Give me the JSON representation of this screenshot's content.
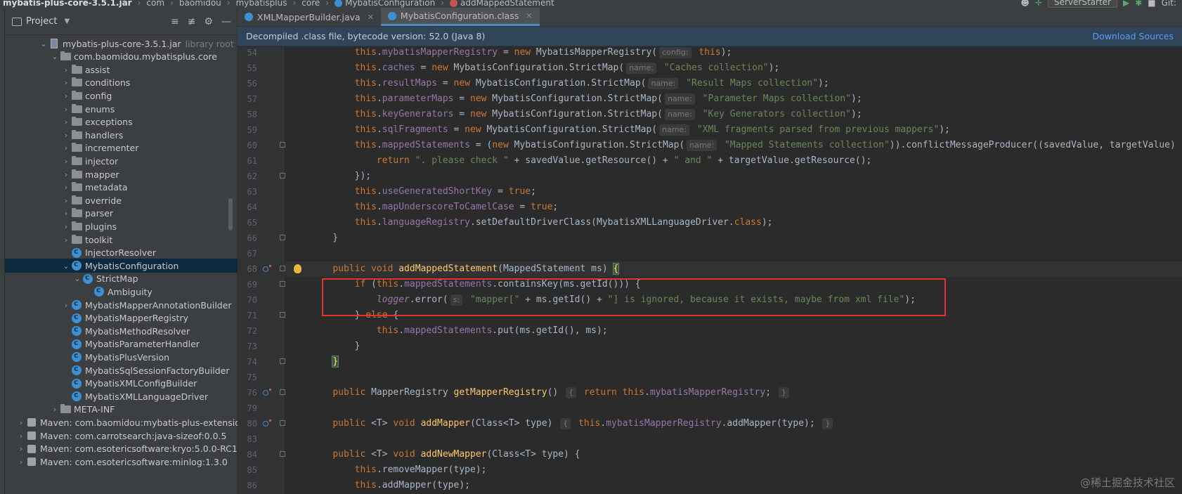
{
  "breadcrumb": {
    "items": [
      "mybatis-plus-core-3.5.1.jar",
      "com",
      "baomidou",
      "mybatisplus",
      "core",
      "MybatisConfiguration",
      "addMappedStatement"
    ]
  },
  "toolbar": {
    "run_config": "ServerStarter",
    "git_label": "Git:"
  },
  "project_panel": {
    "title": "Project",
    "tree": [
      {
        "label": "mybatis-plus-core-3.5.1.jar",
        "sub": "library root",
        "indent": 3,
        "arrow": "open",
        "icon": "jar"
      },
      {
        "label": "com.baomidou.mybatisplus.core",
        "indent": 4,
        "arrow": "open",
        "icon": "folder"
      },
      {
        "label": "assist",
        "indent": 5,
        "arrow": "closed",
        "icon": "folder"
      },
      {
        "label": "conditions",
        "indent": 5,
        "arrow": "closed",
        "icon": "folder"
      },
      {
        "label": "config",
        "indent": 5,
        "arrow": "closed",
        "icon": "folder"
      },
      {
        "label": "enums",
        "indent": 5,
        "arrow": "closed",
        "icon": "folder"
      },
      {
        "label": "exceptions",
        "indent": 5,
        "arrow": "closed",
        "icon": "folder"
      },
      {
        "label": "handlers",
        "indent": 5,
        "arrow": "closed",
        "icon": "folder"
      },
      {
        "label": "incrementer",
        "indent": 5,
        "arrow": "closed",
        "icon": "folder"
      },
      {
        "label": "injector",
        "indent": 5,
        "arrow": "closed",
        "icon": "folder"
      },
      {
        "label": "mapper",
        "indent": 5,
        "arrow": "closed",
        "icon": "folder"
      },
      {
        "label": "metadata",
        "indent": 5,
        "arrow": "closed",
        "icon": "folder"
      },
      {
        "label": "override",
        "indent": 5,
        "arrow": "closed",
        "icon": "folder"
      },
      {
        "label": "parser",
        "indent": 5,
        "arrow": "closed",
        "icon": "folder"
      },
      {
        "label": "plugins",
        "indent": 5,
        "arrow": "closed",
        "icon": "folder"
      },
      {
        "label": "toolkit",
        "indent": 5,
        "arrow": "closed",
        "icon": "folder"
      },
      {
        "label": "InjectorResolver",
        "indent": 5,
        "arrow": "none",
        "icon": "class"
      },
      {
        "label": "MybatisConfiguration",
        "indent": 5,
        "arrow": "open",
        "icon": "class",
        "selected": true
      },
      {
        "label": "StrictMap",
        "indent": 6,
        "arrow": "open",
        "icon": "class"
      },
      {
        "label": "Ambiguity",
        "indent": 7,
        "arrow": "none",
        "icon": "class"
      },
      {
        "label": "MybatisMapperAnnotationBuilder",
        "indent": 5,
        "arrow": "closed",
        "icon": "class"
      },
      {
        "label": "MybatisMapperRegistry",
        "indent": 5,
        "arrow": "none",
        "icon": "class"
      },
      {
        "label": "MybatisMethodResolver",
        "indent": 5,
        "arrow": "none",
        "icon": "class"
      },
      {
        "label": "MybatisParameterHandler",
        "indent": 5,
        "arrow": "none",
        "icon": "class"
      },
      {
        "label": "MybatisPlusVersion",
        "indent": 5,
        "arrow": "none",
        "icon": "class"
      },
      {
        "label": "MybatisSqlSessionFactoryBuilder",
        "indent": 5,
        "arrow": "none",
        "icon": "class"
      },
      {
        "label": "MybatisXMLConfigBuilder",
        "indent": 5,
        "arrow": "none",
        "icon": "class"
      },
      {
        "label": "MybatisXMLLanguageDriver",
        "indent": 5,
        "arrow": "none",
        "icon": "class"
      },
      {
        "label": "META-INF",
        "indent": 4,
        "arrow": "closed",
        "icon": "folder"
      },
      {
        "label": "Maven: com.baomidou:mybatis-plus-extension",
        "indent": 1,
        "arrow": "closed",
        "icon": "maven"
      },
      {
        "label": "Maven: com.carrotsearch:java-sizeof:0.0.5",
        "indent": 1,
        "arrow": "closed",
        "icon": "maven"
      },
      {
        "label": "Maven: com.esotericsoftware:kryo:5.0.0-RC1",
        "indent": 1,
        "arrow": "closed",
        "icon": "maven"
      },
      {
        "label": "Maven: com.esotericsoftware:minlog:1.3.0",
        "indent": 1,
        "arrow": "closed",
        "icon": "maven"
      }
    ]
  },
  "editor": {
    "tabs": [
      {
        "label": "XMLMapperBuilder.java",
        "active": false
      },
      {
        "label": "MybatisConfiguration.class",
        "active": true
      }
    ],
    "decompiled_notice": "Decompiled .class file, bytecode version: 52.0 (Java 8)",
    "download_sources": "Download Sources",
    "code_lines": [
      {
        "n": "54",
        "html": "        <span class='kw'>this</span>.<span class='fld'>mybatisMapperRegistry</span> = <span class='kw'>new</span> MybatisMapperRegistry(<span class='hint'>config:</span> <span class='kw'>this</span>);"
      },
      {
        "n": "55",
        "html": "        <span class='kw'>this</span>.<span class='fld'>caches</span> = <span class='kw'>new</span> MybatisConfiguration.StrictMap(<span class='hint'>name:</span> <span class='str'>\"Caches collection\"</span>);"
      },
      {
        "n": "56",
        "html": "        <span class='kw'>this</span>.<span class='fld'>resultMaps</span> = <span class='kw'>new</span> MybatisConfiguration.StrictMap(<span class='hint'>name:</span> <span class='str'>\"Result Maps collection\"</span>);"
      },
      {
        "n": "57",
        "html": "        <span class='kw'>this</span>.<span class='fld'>parameterMaps</span> = <span class='kw'>new</span> MybatisConfiguration.StrictMap(<span class='hint'>name:</span> <span class='str'>\"Parameter Maps collection\"</span>);"
      },
      {
        "n": "58",
        "html": "        <span class='kw'>this</span>.<span class='fld'>keyGenerators</span> = <span class='kw'>new</span> MybatisConfiguration.StrictMap(<span class='hint'>name:</span> <span class='str'>\"Key Generators collection\"</span>);"
      },
      {
        "n": "59",
        "html": "        <span class='kw'>this</span>.<span class='fld'>sqlFragments</span> = <span class='kw'>new</span> MybatisConfiguration.StrictMap(<span class='hint'>name:</span> <span class='str'>\"XML fragments parsed from previous mappers\"</span>);"
      },
      {
        "n": "60",
        "html": "        <span class='kw'>this</span>.<span class='fld'>mappedStatements</span> = (<span class='kw'>new</span> MybatisConfiguration.StrictMap(<span class='hint'>name:</span> <span class='str'>\"Mapped Statements collection\"</span>)).conflictMessageProducer((savedValue, targetValue) -&gt;",
        "fold": true
      },
      {
        "n": "61",
        "html": "            <span class='kw'>return</span> <span class='str'>\". please check \"</span> + savedValue.getResource() + <span class='str'>\" and \"</span> + targetValue.getResource();"
      },
      {
        "n": "62",
        "html": "        });",
        "fold": true
      },
      {
        "n": "63",
        "html": "        <span class='kw'>this</span>.<span class='fld'>useGeneratedShortKey</span> = <span class='kw'>true</span>;"
      },
      {
        "n": "64",
        "html": "        <span class='kw'>this</span>.<span class='fld'>mapUnderscoreToCamelCase</span> = <span class='kw'>true</span>;"
      },
      {
        "n": "65",
        "html": "        <span class='kw'>this</span>.<span class='fld'>languageRegistry</span>.setDefaultDriverClass(MybatisXMLLanguageDriver.<span class='kw'>class</span>);"
      },
      {
        "n": "66",
        "html": "    }",
        "fold": true
      },
      {
        "n": "67",
        "html": ""
      },
      {
        "n": "68",
        "html": "    <span class='kw'>public void</span> <span class='fn'>addMappedStatement</span>(MappedStatement ms) <span class='brace-hl'>{</span>",
        "gi": true,
        "fold": true,
        "bulb": true,
        "current": true
      },
      {
        "n": "69",
        "html": "        <span class='kw'>if</span> (<span class='kw'>this</span>.<span class='fld'>mappedStatements</span>.containsKey(ms.getId())) {",
        "fold": true
      },
      {
        "n": "70",
        "html": "            <span class='fld ital'>logger</span>.error(<span class='hint'>s:</span> <span class='str'>\"mapper[\"</span> + ms.getId() + <span class='str'>\"] is ignored, because it exists, maybe from xml file\"</span>);"
      },
      {
        "n": "71",
        "html": "        } <span class='kw'>else</span> {",
        "fold": true
      },
      {
        "n": "72",
        "html": "            <span class='kw'>this</span>.<span class='fld'>mappedStatements</span>.put(ms.getId(), ms);"
      },
      {
        "n": "73",
        "html": "        }"
      },
      {
        "n": "74",
        "html": "    <span class='brace-hl'>}</span>",
        "fold": true
      },
      {
        "n": "75",
        "html": ""
      },
      {
        "n": "76",
        "html": "    <span class='kw'>public</span> MapperRegistry <span class='fn'>getMapperRegistry</span>() <span class='hint'>{</span> <span class='kw'>return this</span>.<span class='fld'>mybatisMapperRegistry</span>; <span class='hint'>}</span>",
        "gi": true,
        "fold": true
      },
      {
        "n": "79",
        "html": ""
      },
      {
        "n": "80",
        "html": "    <span class='kw'>public</span> &lt;T&gt; <span class='kw'>void</span> <span class='fn'>addMapper</span>(Class&lt;T&gt; type) <span class='hint'>{</span> <span class='kw'>this</span>.<span class='fld'>mybatisMapperRegistry</span>.addMapper(type); <span class='hint'>}</span>",
        "gi": true,
        "fold": true
      },
      {
        "n": "83",
        "html": ""
      },
      {
        "n": "84",
        "html": "    <span class='kw'>public</span> &lt;T&gt; <span class='kw'>void</span> <span class='fn'>addNewMapper</span>(Class&lt;T&gt; type) {",
        "fold": true
      },
      {
        "n": "85",
        "html": "        <span class='kw'>this</span>.removeMapper(type);"
      },
      {
        "n": "86",
        "html": "        <span class='kw'>this</span>.addMapper(type);"
      }
    ]
  },
  "watermark": "@稀土掘金技术社区",
  "colors": {
    "accent": "#4a88c7",
    "highlight_box": "#e0342e",
    "selection": "#0d293e"
  }
}
